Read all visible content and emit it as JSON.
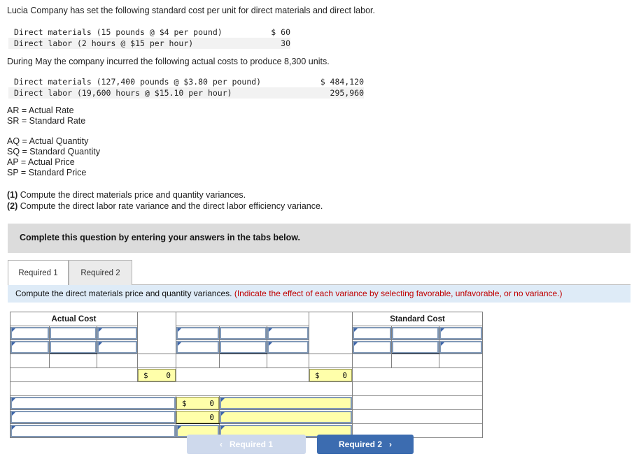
{
  "problem": {
    "intro_standard": "Lucia Company has set the following standard cost per unit for direct materials and direct labor.",
    "intro_actual": "During May the company incurred the following actual costs to produce 8,300 units.",
    "standard_rows": [
      {
        "label": "Direct materials (15 pounds @ $4 per pound)",
        "amount": "$ 60"
      },
      {
        "label": "Direct labor (2 hours @ $15 per hour)",
        "amount": "30"
      }
    ],
    "actual_rows": [
      {
        "label": "Direct materials (127,400 pounds @ $3.80 per pound)",
        "amount": "$ 484,120"
      },
      {
        "label": "Direct labor (19,600 hours @ $15.10 per hour)",
        "amount": "295,960"
      }
    ],
    "legend_rate": [
      "AR = Actual Rate",
      "SR = Standard Rate"
    ],
    "legend_quantity": [
      "AQ = Actual Quantity",
      "SQ = Standard Quantity",
      "AP = Actual Price",
      "SP = Standard Price"
    ],
    "requirements": [
      {
        "number": "(1)",
        "text": " Compute the direct materials price and quantity variances."
      },
      {
        "number": "(2)",
        "text": " Compute the direct labor rate variance and the direct labor efficiency variance."
      }
    ]
  },
  "complete_bar": {
    "text": "Complete this question by entering your answers in the tabs below."
  },
  "tabs": [
    {
      "label": "Required 1",
      "active": true
    },
    {
      "label": "Required 2",
      "active": false
    }
  ],
  "instruction": {
    "main": "Compute the direct materials price and quantity variances. ",
    "hint": "(Indicate the effect of each variance by selecting favorable, unfavorable, or no variance.)"
  },
  "worksheet": {
    "header_actual": "Actual Cost",
    "header_standard": "Standard Cost",
    "totals": {
      "actual_dollar": "$",
      "actual_value": "0",
      "standard_dollar": "$",
      "standard_value": "0"
    },
    "variance_rows": [
      {
        "dollar": "$",
        "value": "0",
        "selected": false
      },
      {
        "dollar": "",
        "value": "0",
        "selected": false
      },
      {
        "dollar": "",
        "value": "",
        "selected": true
      }
    ]
  },
  "nav": {
    "prev_label": "Required 1",
    "prev_chevron": "‹",
    "next_label": "Required 2",
    "next_chevron": "›"
  },
  "colors": {
    "header_blue": "#82aee3",
    "instruction_bg": "#deebf7",
    "complete_bar_bg": "#dcdcdc",
    "input_yellow": "#ffffaa",
    "next_button": "#3c6cb0",
    "prev_button": "#ced9ec",
    "hint_red": "#c00000"
  }
}
